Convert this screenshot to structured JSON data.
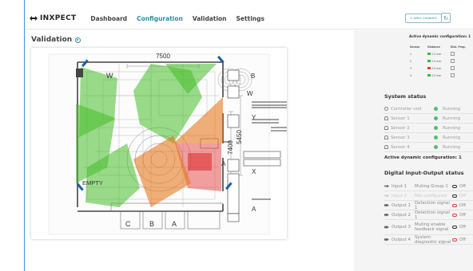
{
  "app": {
    "name": "INXPECT"
  },
  "nav": {
    "items": [
      "Dashboard",
      "Configuration",
      "Validation",
      "Settings"
    ],
    "active": "Configuration"
  },
  "toolbar": {
    "apply_label": "✔ APPLY CHANGES",
    "refresh_icon": "refresh-icon"
  },
  "page": {
    "title": "Validation"
  },
  "floorplan": {
    "dims": {
      "top": "7500",
      "right_a": "7400",
      "right_b": "5450"
    },
    "labels": {
      "w1": "W",
      "w2": "W",
      "b": "B",
      "y": "Y",
      "x": "X",
      "a_inner": "A",
      "a_outer": "A",
      "empty": "EMPTY",
      "c": "C",
      "b_bottom": "B",
      "a_bottom": "A"
    }
  },
  "active_dynamic": {
    "title": "Active dynamic configuration: 1",
    "headers": [
      "Sensor",
      "Distance",
      "Dist. Prog."
    ],
    "rows": [
      {
        "sensor": "1",
        "color": "#3fb54a",
        "distance": "2.5 mm"
      },
      {
        "sensor": "2",
        "color": "#3fb54a",
        "distance": "2.5 mm"
      },
      {
        "sensor": "3",
        "color": "#e04040",
        "distance": "2.5 mm"
      },
      {
        "sensor": "4",
        "color": "#3fb54a",
        "distance": "2.5 mm"
      }
    ]
  },
  "system_status": {
    "title": "System status",
    "rows": [
      {
        "name": "Controller unit",
        "status": "Running"
      },
      {
        "name": "Sensor 1",
        "status": "Running"
      },
      {
        "name": "Sensor 2",
        "status": "Running"
      },
      {
        "name": "Sensor 3",
        "status": "Running"
      },
      {
        "name": "Sensor 4",
        "status": "Running"
      }
    ],
    "active_config": "Active dynamic configuration: 1"
  },
  "io_status": {
    "title": "Digital Input-Output status",
    "rows": [
      {
        "name": "Input 1",
        "desc": "Muting Group 1",
        "state": "Off",
        "active": true,
        "ring": "dark"
      },
      {
        "name": "Input 2",
        "desc": "Not configured",
        "state": "Off",
        "active": false,
        "ring": "dark"
      },
      {
        "name": "Output 1",
        "desc": "Detection signal 1",
        "state": "Off",
        "active": true,
        "ring": "red"
      },
      {
        "name": "Output 2",
        "desc": "Detection signal 1",
        "state": "Off",
        "active": true,
        "ring": "red"
      },
      {
        "name": "Output 3",
        "desc": "Muting enable feedback signal",
        "state": "Off",
        "active": true,
        "ring": "dark"
      },
      {
        "name": "Output 4",
        "desc": "System diagnostic signal",
        "state": "Off",
        "active": true,
        "ring": "red"
      }
    ]
  }
}
